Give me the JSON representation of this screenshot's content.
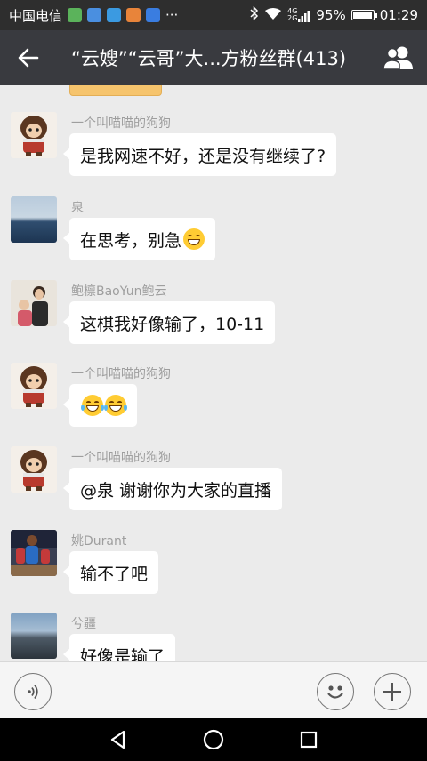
{
  "status_bar": {
    "carrier": "中国电信",
    "more": "···",
    "network": "4G",
    "network2": "2G",
    "battery": "95%",
    "battery_level": 0.95,
    "time": "01:29"
  },
  "header": {
    "title": "“云嫂”“云哥”大...方粉丝群(413)"
  },
  "messages": [
    {
      "sender": "一个叫喵喵的狗狗",
      "text": "是我网速不好，还是没有继续了?",
      "avatar": "monchhichi-avatar"
    },
    {
      "sender": "泉",
      "text": "在思考，别急",
      "emoji": "grin-emoji",
      "avatar": "sea-avatar"
    },
    {
      "sender": "鲍檩BaoYun鲍云",
      "text": "这棋我好像输了，10-11",
      "avatar": "photo-avatar"
    },
    {
      "sender": "一个叫喵喵的狗狗",
      "text": "",
      "emoji": "tears-of-joy-emoji",
      "avatar": "monchhichi-avatar"
    },
    {
      "sender": "一个叫喵喵的狗狗",
      "text": "@泉 谢谢你为大家的直播",
      "avatar": "monchhichi-avatar"
    },
    {
      "sender": "姚Durant",
      "text": "输不了吧",
      "avatar": "basketball-avatar"
    },
    {
      "sender": "兮疆",
      "text": "好像是输了",
      "avatar": "mountain-avatar"
    }
  ],
  "colors": {
    "status_bg": "#2e2e2e",
    "header_bg": "#393a3f",
    "chat_bg": "#ebebeb",
    "bubble_bg": "#ffffff"
  }
}
